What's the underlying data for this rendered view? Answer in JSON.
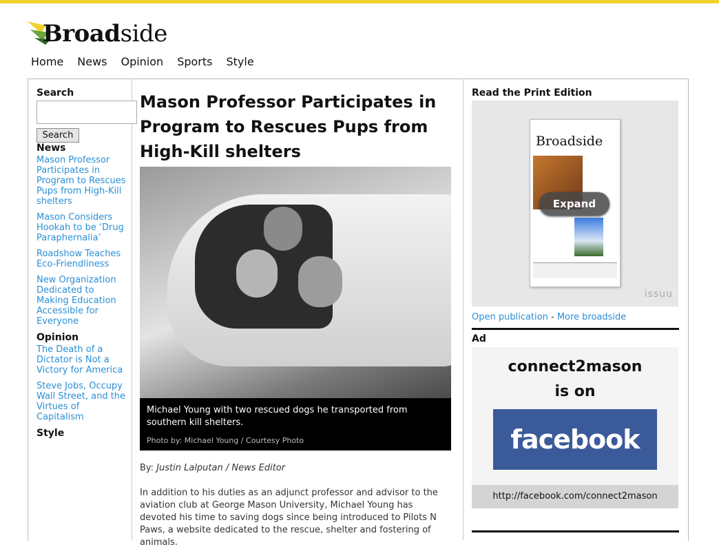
{
  "site": {
    "logo_bold": "Broad",
    "logo_rest": "side"
  },
  "nav": [
    "Home",
    "News",
    "Opinion",
    "Sports",
    "Style"
  ],
  "sidebar": {
    "search_heading": "Search",
    "search_placeholder": "",
    "search_button": "Search",
    "sections": [
      {
        "title": "News",
        "items": [
          "Mason Professor Participates in Program to Rescues Pups from High-Kill shelters",
          "Mason Considers Hookah to be ‘Drug Paraphernalia’",
          "Roadshow Teaches Eco-Friendliness",
          "New Organization Dedicated to Making Education Accessible for Everyone"
        ]
      },
      {
        "title": "Opinion",
        "items": [
          "The Death of a Dictator is Not a Victory for America",
          "Steve Jobs, Occupy Wall Street, and the Virtues of Capitalism"
        ]
      },
      {
        "title": "Style",
        "items": []
      }
    ]
  },
  "article": {
    "headline": "Mason Professor Participates in Program to Rescues Pups from High-Kill shelters",
    "caption": "Michael Young with two rescued dogs he transported from southern kill shelters.",
    "photo_credit": "Photo by: Michael Young / Courtesy Photo",
    "byline_prefix": "By: ",
    "byline_author": "Justin Lalputan / News Editor",
    "body": "In addition to his duties as an adjunct professor and advisor to the aviation club at George Mason University, Michael Young has devoted his time to saving dogs since being introduced to Pilots N Paws, a website dedicated to the rescue, shelter and fostering of animals."
  },
  "right": {
    "print_heading": "Read the Print Edition",
    "expand_label": "Expand",
    "issuu_mark": "issuu",
    "cover_logo": "Broadside",
    "open_pub": "Open publication",
    "sep": " - ",
    "more": "More broadside",
    "ad_heading": "Ad",
    "ad_line1": "connect2mason",
    "ad_line2": "is on",
    "ad_brand": "facebook",
    "ad_url": "http://facebook.com/connect2mason"
  },
  "colors": {
    "accent_bar": "#f2d22e",
    "link": "#2a8fd6",
    "facebook": "#3b5a9a"
  }
}
